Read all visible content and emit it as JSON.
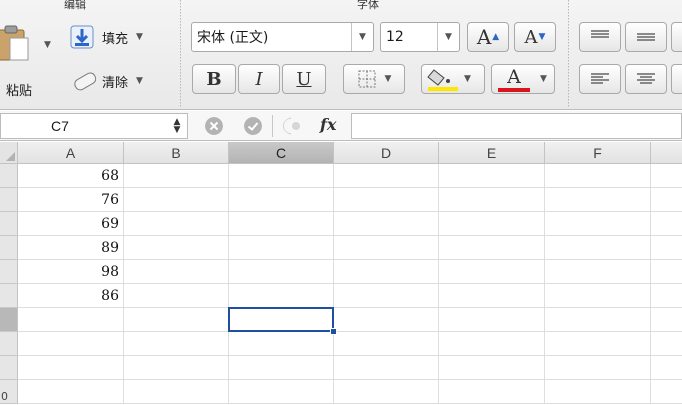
{
  "ribbon": {
    "groups": {
      "edit": "编辑",
      "font": "字体"
    },
    "paste_label": "粘贴",
    "fill_label": "填充",
    "clear_label": "清除",
    "font_name": "宋体 (正文)",
    "font_size": "12",
    "bold_label": "B",
    "italic_label": "I",
    "underline_label": "U",
    "grow_font_label": "A",
    "shrink_font_label": "A",
    "font_color_label": "A",
    "highlight_color": "#ffe600",
    "font_color": "#d8141c"
  },
  "formula_bar": {
    "name_box": "C7",
    "fx_label": "fx",
    "formula": ""
  },
  "grid": {
    "columns": [
      "A",
      "B",
      "C",
      "D",
      "E",
      "F"
    ],
    "selected_column": "C",
    "rows": [
      "",
      "",
      "",
      "",
      "",
      "",
      "",
      "",
      "",
      "0"
    ],
    "values_col_a": [
      "68",
      "76",
      "69",
      "89",
      "98",
      "86"
    ],
    "active_cell": "C7",
    "accent": "#1f4fa3"
  }
}
